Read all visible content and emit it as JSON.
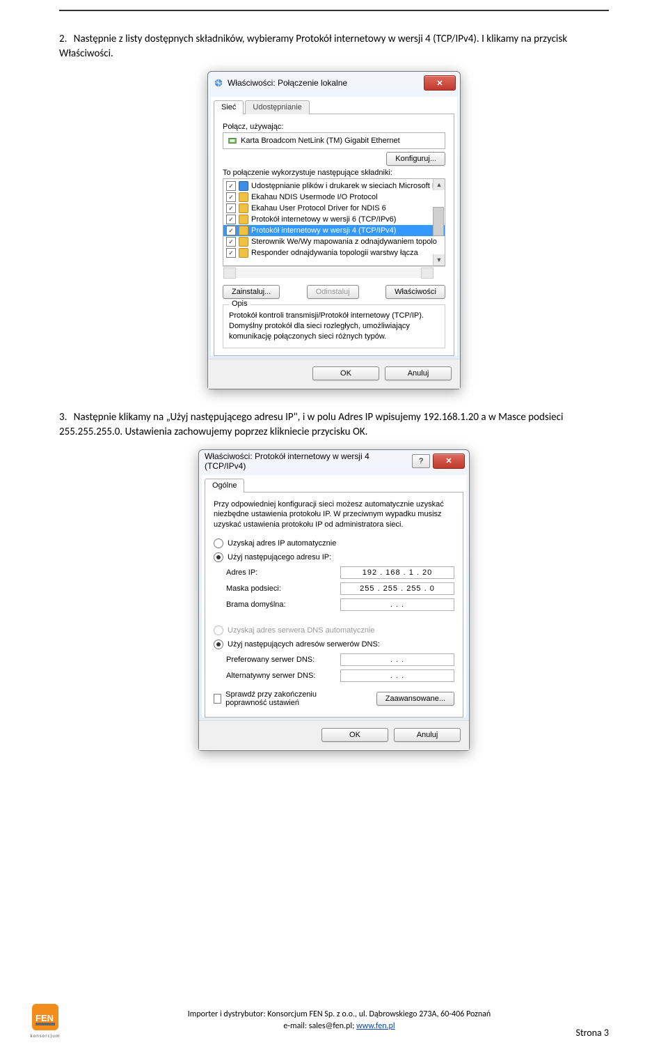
{
  "step2": {
    "num": "2.",
    "text": "Następnie z listy dostępnych składników, wybieramy Protokół internetowy w wersji 4 (TCP/IPv4). I klikamy na przycisk Właściwości."
  },
  "dialog1": {
    "title": "Właściwości: Połączenie lokalne",
    "tabs": [
      "Sieć",
      "Udostępnianie"
    ],
    "connect_label": "Połącz, używając:",
    "adapter": "Karta Broadcom NetLink (TM) Gigabit Ethernet",
    "configure_btn": "Konfiguruj...",
    "components_label": "To połączenie wykorzystuje następujące składniki:",
    "items": [
      "Udostępnianie plików i drukarek w sieciach Microsoft N",
      "Ekahau NDIS Usermode I/O Protocol",
      "Ekahau User Protocol Driver for NDIS 6",
      "Protokół internetowy w wersji 6 (TCP/IPv6)",
      "Protokół internetowy w wersji 4 (TCP/IPv4)",
      "Sterownik We/Wy mapowania z odnajdywaniem topolo",
      "Responder odnajdywania topologii warstwy łącza"
    ],
    "install_btn": "Zainstaluj...",
    "uninstall_btn": "Odinstaluj",
    "properties_btn": "Właściwości",
    "desc_legend": "Opis",
    "desc_text": "Protokół kontroli transmisji/Protokół internetowy (TCP/IP). Domyślny protokół dla sieci rozległych, umożliwiający komunikację połączonych sieci różnych typów.",
    "ok": "OK",
    "cancel": "Anuluj"
  },
  "step3": {
    "num": "3.",
    "text": "Następnie klikamy na „Użyj następującego adresu IP\",  i w polu Adres IP wpisujemy 192.168.1.20 a w Masce podsieci 255.255.255.0. Ustawienia zachowujemy poprzez klikniecie przycisku OK."
  },
  "dialog2": {
    "title": "Właściwości: Protokół internetowy w wersji 4 (TCP/IPv4)",
    "tab": "Ogólne",
    "intro": "Przy odpowiedniej konfiguracji sieci możesz automatycznie uzyskać niezbędne ustawienia protokołu IP. W przeciwnym wypadku musisz uzyskać ustawienia protokołu IP od administratora sieci.",
    "radio_auto": "Uzyskaj adres IP automatycznie",
    "radio_static": "Użyj następującego adresu IP:",
    "ip_label": "Adres IP:",
    "ip_value": "192 . 168 .   1  .  20",
    "mask_label": "Maska podsieci:",
    "mask_value": "255 . 255 . 255 .   0",
    "gw_label": "Brama domyślna:",
    "gw_value": ".        .        .",
    "dns_auto": "Uzyskaj adres serwera DNS automatycznie",
    "dns_static": "Użyj następujących adresów serwerów DNS:",
    "dns_pref_label": "Preferowany serwer DNS:",
    "dns_pref_value": ".        .        .",
    "dns_alt_label": "Alternatywny serwer DNS:",
    "dns_alt_value": ".        .        .",
    "verify": "Sprawdź przy zakończeniu poprawność ustawień",
    "advanced": "Zaawansowane...",
    "ok": "OK",
    "cancel": "Anuluj"
  },
  "footer": {
    "line1": "Importer i dystrybutor: Konsorcjum FEN Sp. z o.o., ul. Dąbrowskiego 273A, 60-406 Poznań",
    "line2_pre": "e-mail: sales@fen.pl; ",
    "link": "www.fen.pl",
    "logo_label": "konsorcjum",
    "page": "Strona 3"
  }
}
